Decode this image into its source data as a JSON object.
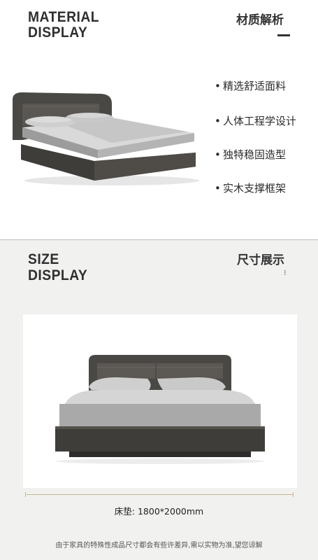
{
  "material": {
    "title_line1": "MATERIAL",
    "title_line2": "DISPLAY",
    "cn_title": "材质解析",
    "features": [
      "精选舒适面料",
      "人体工程学设计",
      "独特稳固造型",
      "实木支撑框架"
    ],
    "bullet": "•"
  },
  "size": {
    "title_line1": "SIZE",
    "title_line2": "DISPLAY",
    "cn_title": "尺寸展示",
    "small_glyph": "⁝",
    "mattress_label": "床垫:",
    "mattress_value": "1800*2000mm",
    "note": "由于家具的特殊性成品尺寸都会有些许差异,需以实物为准,望您谅解"
  },
  "colors": {
    "frame": "#4a4845",
    "sheet": "#b9b9b9",
    "pillow": "#cfcfcf",
    "accent_line": "#c9b68d"
  }
}
